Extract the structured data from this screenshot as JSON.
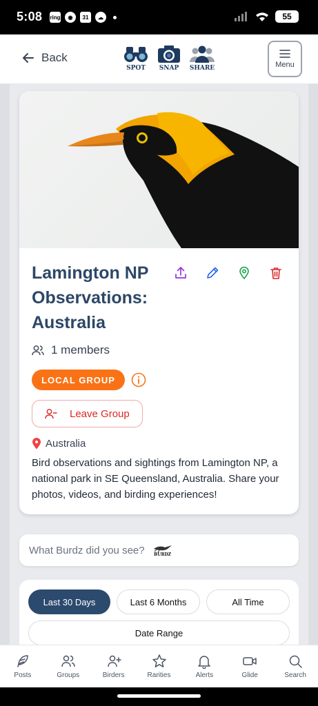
{
  "status_bar": {
    "time": "5:08",
    "battery": "55",
    "notification_icons": [
      "ring",
      "chrome",
      "calendar-31",
      "cloud"
    ]
  },
  "header": {
    "back_label": "Back",
    "logos": [
      {
        "label": "SPOT",
        "icon": "binoculars-icon"
      },
      {
        "label": "SNAP",
        "icon": "camera-icon"
      },
      {
        "label": "SHARE",
        "icon": "people-icon"
      }
    ],
    "menu_label": "Menu"
  },
  "group": {
    "title": "Lamington NP Observations: Australia",
    "members": "1 members",
    "badge": "LOCAL GROUP",
    "leave_label": "Leave Group",
    "location": "Australia",
    "description": "Bird observations and sightings from Lamington NP, a national park in SE Queensland, Australia. Share your photos, videos, and birding experiences!",
    "photo_subject": "Regent Bowerbird",
    "colors": {
      "title": "#2d4766",
      "badge": "#f97316",
      "leave": "#dc2626",
      "share": "#9333ea",
      "edit": "#2563eb",
      "location": "#16a34a",
      "delete": "#dc2626"
    }
  },
  "search": {
    "placeholder": "What Burdz did you see?",
    "brand": "BURDZ"
  },
  "filters": {
    "options": [
      "Last 30 Days",
      "Last 6 Months",
      "All Time"
    ],
    "selected": "Last 30 Days",
    "date_range_label": "Date Range"
  },
  "bottom_nav": [
    {
      "label": "Posts",
      "icon": "feather-icon"
    },
    {
      "label": "Groups",
      "icon": "groups-icon"
    },
    {
      "label": "Birders",
      "icon": "add-user-icon"
    },
    {
      "label": "Rarities",
      "icon": "star-icon"
    },
    {
      "label": "Alerts",
      "icon": "bell-icon"
    },
    {
      "label": "Glide",
      "icon": "video-icon"
    },
    {
      "label": "Search",
      "icon": "search-icon"
    }
  ]
}
